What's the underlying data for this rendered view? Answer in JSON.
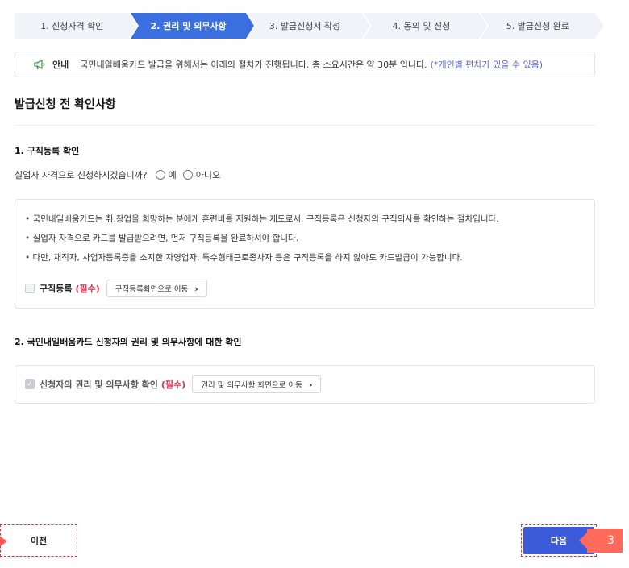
{
  "steps": [
    {
      "label": "1. 신청자격 확인"
    },
    {
      "label": "2. 권리 및 의무사항"
    },
    {
      "label": "3. 발급신청서 작성"
    },
    {
      "label": "4. 동의 및 신청"
    },
    {
      "label": "5. 발급신청 완료"
    }
  ],
  "active_step": 2,
  "notice": {
    "icon": "megaphone-icon",
    "label": "안내",
    "text": "국민내일배움카드 발급을 위해서는 아래의 절차가 진행됩니다. 총 소요시간은 약 30분 입니다.",
    "note": "(*개인별 편차가 있을 수 있음)"
  },
  "section_title": "발급신청 전 확인사항",
  "section1": {
    "title": "1. 구직등록 확인",
    "question": "실업자 자격으로 신청하시겠습니까?",
    "option_yes": "예",
    "option_no": "아니오",
    "bullets": [
      "국민내일배움카드는 취.창업을 희망하는 분에게 훈련비를 지원하는 제도로서, 구직등록은 신청자의 구직의사를 확인하는 절차입니다.",
      "실업자 자격으로 카드를 발급받으려면, 먼저 구직등록을 완료하셔야 합니다.",
      "다만, 재직자, 사업자등록증을 소지한 자영업자, 특수형태근로종사자 등은 구직등록을 하지 않아도 카드발급이 가능합니다."
    ],
    "check_label": "구직등록",
    "required": "(필수)",
    "link_label": "구직등록화면으로 이동"
  },
  "section2": {
    "title": "2. 국민내일배움카드 신청자의 권리 및 의무사항에 대한 확인",
    "check_label": "신청자의 권리 및 의무사항 확인",
    "required": "(필수)",
    "link_label": "권리 및 의무사항 화면으로 이동"
  },
  "footer": {
    "prev_label": "이전",
    "next_label": "다음",
    "callout_number": "3"
  },
  "colors": {
    "accent": "#3b6fe0",
    "next_button": "#3b5bdb",
    "required": "#e0304b",
    "note": "#5a66d8",
    "callout": "#ff6b5b"
  }
}
